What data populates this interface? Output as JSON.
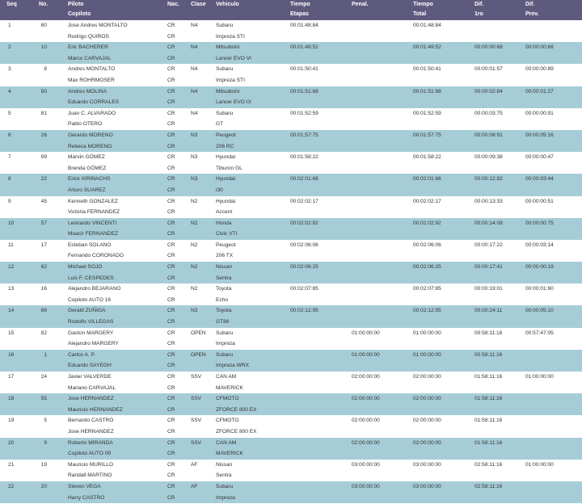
{
  "header": {
    "seq": "Seq",
    "no": "No.",
    "piloto": "Piloto",
    "copiloto": "Copiloto",
    "nac": "Nac.",
    "clase": "Clase",
    "vehiculo": "Vehiculo",
    "tiempo_etapas_1": "Tiempo",
    "tiempo_etapas_2": "Etapas",
    "penal": "Penal.",
    "tiempo_total_1": "Tiempo",
    "tiempo_total_2": "Total",
    "dif1_1": "Dif.",
    "dif1_2": "1ro",
    "dif2_1": "Dif.",
    "dif2_2": "Prev."
  },
  "rows": [
    {
      "seq": "1",
      "no": "80",
      "piloto": "Jose Andres MONTALTO",
      "copiloto": "Rodrigo QUIROS",
      "nac1": "CR",
      "nac2": "CR",
      "clase": "N4",
      "marca": "Subaru",
      "modelo": "Impreza STI",
      "etapas": "00:01:48:84",
      "penal": "",
      "total": "00:01:48:84",
      "dif1": "",
      "dif2": ""
    },
    {
      "seq": "2",
      "no": "10",
      "piloto": "Eric BACHERER",
      "copiloto": "Marco CARVAJAL",
      "nac1": "CR",
      "nac2": "CR",
      "clase": "N4",
      "marca": "Mitsubishi",
      "modelo": "Lancer EVO VI",
      "etapas": "00:01:49:52",
      "penal": "",
      "total": "00:01:49:52",
      "dif1": "00:00:00:68",
      "dif2": "00:00:00:68"
    },
    {
      "seq": "3",
      "no": "8",
      "piloto": "Andres MONTALTO",
      "copiloto": "Max ROHRMOSER",
      "nac1": "CR",
      "nac2": "CR",
      "clase": "N4",
      "marca": "Subaru",
      "modelo": "Impreza STI",
      "etapas": "00:01:50:41",
      "penal": "",
      "total": "00:01:50:41",
      "dif1": "00:00:01:57",
      "dif2": "00:00:00:89"
    },
    {
      "seq": "4",
      "no": "50",
      "piloto": "Andres MOLINA",
      "copiloto": "Eduardo CORRALES",
      "nac1": "CR",
      "nac2": "CR",
      "clase": "N4",
      "marca": "Mitsubishi",
      "modelo": "Lancer EVO IX",
      "etapas": "00:01:51:68",
      "penal": "",
      "total": "00:01:51:68",
      "dif1": "00:00:02:84",
      "dif2": "00:00:01:27"
    },
    {
      "seq": "5",
      "no": "81",
      "piloto": "Juan C. ALVARADO",
      "copiloto": "Pablo OTERO",
      "nac1": "CR",
      "nac2": "CR",
      "clase": "N4",
      "marca": "Subaru",
      "modelo": "GT",
      "etapas": "00:01:52:59",
      "penal": "",
      "total": "00:01:52:59",
      "dif1": "00:00:03:75",
      "dif2": "00:00:00:91"
    },
    {
      "seq": "6",
      "no": "26",
      "piloto": "Gerardo MORENO",
      "copiloto": "Rebeca MORENO",
      "nac1": "CR",
      "nac2": "CR",
      "clase": "N3",
      "marca": "Peugeot",
      "modelo": "206 RC",
      "etapas": "00:01:57:75",
      "penal": "",
      "total": "00:01:57:75",
      "dif1": "00:00:08:91",
      "dif2": "00:00:05:16"
    },
    {
      "seq": "7",
      "no": "99",
      "piloto": "Marvin GÓMEZ",
      "copiloto": "Brenda GÓMEZ",
      "nac1": "CR",
      "nac2": "CR",
      "clase": "N3",
      "marca": "Hyundai",
      "modelo": "Tiburon GL",
      "etapas": "00:01:58:22",
      "penal": "",
      "total": "00:01:58:22",
      "dif1": "00:00:09:38",
      "dif2": "00:00:00:47"
    },
    {
      "seq": "8",
      "no": "22",
      "piloto": "Erick XIRINACHS",
      "copiloto": "Arturo SUAREZ",
      "nac1": "CR",
      "nac2": "CR",
      "clase": "N3",
      "marca": "Hyundai",
      "modelo": "i30",
      "etapas": "00:02:01:66",
      "penal": "",
      "total": "00:02:01:66",
      "dif1": "00:00:12:82",
      "dif2": "00:00:03:44"
    },
    {
      "seq": "9",
      "no": "45",
      "piloto": "Kenneth GONZALEZ",
      "copiloto": "Victoria FERNANDEZ",
      "nac1": "CR",
      "nac2": "CR",
      "clase": "N2",
      "marca": "Hyundai",
      "modelo": "Accent",
      "etapas": "00:02:02:17",
      "penal": "",
      "total": "00:02:02:17",
      "dif1": "00:00:13:33",
      "dif2": "00:00:00:51"
    },
    {
      "seq": "10",
      "no": "57",
      "piloto": "Leonardo VINCENTI",
      "copiloto": "Moacir FERNANDEZ",
      "nac1": "CR",
      "nac2": "CR",
      "clase": "N2",
      "marca": "Honda",
      "modelo": "Civic VTI",
      "etapas": "00:02:02:92",
      "penal": "",
      "total": "00:02:02:92",
      "dif1": "00:00:14:08",
      "dif2": "00:00:00:75"
    },
    {
      "seq": "11",
      "no": "17",
      "piloto": "Esteban SOLANO",
      "copiloto": "Fernando CORONADO",
      "nac1": "CR",
      "nac2": "CR",
      "clase": "N2",
      "marca": "Peugeot",
      "modelo": "206 TX",
      "etapas": "00:02:06:06",
      "penal": "",
      "total": "00:02:06:06",
      "dif1": "00:00:17:22",
      "dif2": "00:00:03:14"
    },
    {
      "seq": "12",
      "no": "62",
      "piloto": "Michael SOJO",
      "copiloto": "Luis F. CESPEDES",
      "nac1": "CR",
      "nac2": "CR",
      "clase": "N2",
      "marca": "Nissan",
      "modelo": "Sentra",
      "etapas": "00:02:06:25",
      "penal": "",
      "total": "00:02:06:25",
      "dif1": "00:00:17:41",
      "dif2": "00:00:00:19"
    },
    {
      "seq": "13",
      "no": "16",
      "piloto": "Alejandro BEJARANO",
      "copiloto": "Copiloto AUTO 16",
      "nac1": "CR",
      "nac2": "CR",
      "clase": "N2",
      "marca": "Toyota",
      "modelo": "Echo",
      "etapas": "00:02:07:85",
      "penal": "",
      "total": "00:02:07:85",
      "dif1": "00:00:19:01",
      "dif2": "00:00:01:60"
    },
    {
      "seq": "14",
      "no": "86",
      "piloto": "Gerald ZUÑIGA",
      "copiloto": "Rodolfo VILLEGAS",
      "nac1": "CR",
      "nac2": "CR",
      "clase": "N3",
      "marca": "Toyota",
      "modelo": "GT86",
      "etapas": "00:02:12:95",
      "penal": "",
      "total": "00:02:12:95",
      "dif1": "00:00:24:11",
      "dif2": "00:00:05:10"
    },
    {
      "seq": "15",
      "no": "82",
      "piloto": "Gaston MARGERY",
      "copiloto": "Alejandro MARGERY",
      "nac1": "CR",
      "nac2": "CR",
      "clase": "OPEN",
      "marca": "Subaru",
      "modelo": "Impreza",
      "etapas": "",
      "penal": "01:00:00:00",
      "total": "01:00:00:00",
      "dif1": "00:58:11:16",
      "dif2": "00:57:47:05"
    },
    {
      "seq": "16",
      "no": "1",
      "piloto": "Carlos A. P.",
      "copiloto": "Eduardo SAYEGH",
      "nac1": "CR",
      "nac2": "CR",
      "clase": "OPEN",
      "marca": "Subaru",
      "modelo": "Impreza WRX",
      "etapas": "",
      "penal": "01:00:00:00",
      "total": "01:00:00:00",
      "dif1": "00:58:11:16",
      "dif2": ""
    },
    {
      "seq": "17",
      "no": "24",
      "piloto": "Javier VALVERDE",
      "copiloto": "Mariano CARVAJAL",
      "nac1": "CR",
      "nac2": "CR",
      "clase": "SSV",
      "marca": "CAN AM",
      "modelo": "MAVERICK",
      "etapas": "",
      "penal": "02:00:00:00",
      "total": "02:00:00:00",
      "dif1": "01:58:11:16",
      "dif2": "01:00:00:00"
    },
    {
      "seq": "18",
      "no": "55",
      "piloto": "Jose HERNANDEZ",
      "copiloto": "Mauricio HERNANDEZ",
      "nac1": "CR",
      "nac2": "CR",
      "clase": "SSV",
      "marca": "CFMOTO",
      "modelo": "ZFORCE 800 EX",
      "etapas": "",
      "penal": "02:00:00:00",
      "total": "02:00:00:00",
      "dif1": "01:58:11:16",
      "dif2": ""
    },
    {
      "seq": "19",
      "no": "5",
      "piloto": "Bernardo CASTRO",
      "copiloto": "Jose HERNANDEZ",
      "nac1": "CR",
      "nac2": "CR",
      "clase": "SSV",
      "marca": "CFMOTO",
      "modelo": "ZFORCE 800 EX",
      "etapas": "",
      "penal": "02:00:00:00",
      "total": "02:00:00:00",
      "dif1": "01:58:11:16",
      "dif2": ""
    },
    {
      "seq": "20",
      "no": "9",
      "piloto": "Roberto MIRANDA",
      "copiloto": "Copiloto AUTO 09",
      "nac1": "CR",
      "nac2": "CR",
      "clase": "SSV",
      "marca": "CAN AM",
      "modelo": "MAVERICK",
      "etapas": "",
      "penal": "02:00:00:00",
      "total": "02:00:00:00",
      "dif1": "01:58:11:16",
      "dif2": ""
    },
    {
      "seq": "21",
      "no": "19",
      "piloto": "Mauricio MURILLO",
      "copiloto": "Randall MARTINO",
      "nac1": "CR",
      "nac2": "CR",
      "clase": "AF",
      "marca": "Nissan",
      "modelo": "Sentra",
      "etapas": "",
      "penal": "03:00:00:00",
      "total": "03:00:00:00",
      "dif1": "02:58:11:16",
      "dif2": "01:00:00:00"
    },
    {
      "seq": "22",
      "no": "20",
      "piloto": "Steven VEGA",
      "copiloto": "Harry CASTRO",
      "nac1": "CR",
      "nac2": "CR",
      "clase": "AF",
      "marca": "Subaru",
      "modelo": "Impreza",
      "etapas": "",
      "penal": "03:00:00:00",
      "total": "03:00:00:00",
      "dif1": "02:58:11:16",
      "dif2": ""
    }
  ]
}
